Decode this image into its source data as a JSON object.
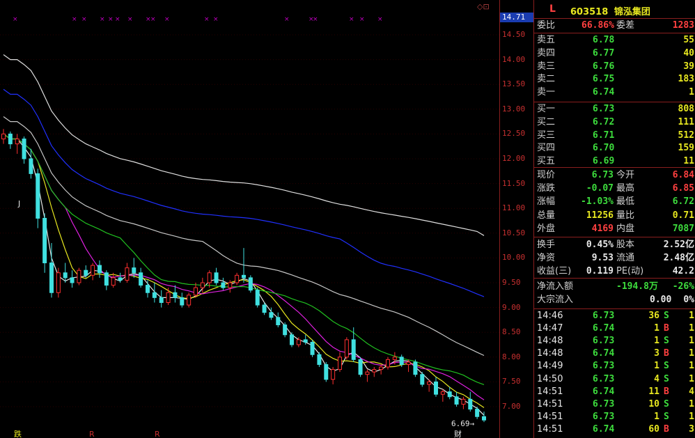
{
  "header": {
    "market_flag": "L",
    "stock_code": "603518",
    "stock_name": "锦泓集团"
  },
  "axis": {
    "current_price_tag": "14.71",
    "ticks": [
      "14.50",
      "14.00",
      "13.50",
      "13.00",
      "12.50",
      "12.00",
      "11.50",
      "11.00",
      "10.50",
      "10.00",
      "9.50",
      "9.00",
      "8.50",
      "8.00",
      "7.50",
      "7.00"
    ],
    "min_price_label": "6.69",
    "corner_icons": "◇⊡"
  },
  "chart_markers": {
    "top_marks": "×",
    "left_mark": "J",
    "bottom_tags": [
      "跌",
      "R",
      "R",
      "财"
    ]
  },
  "chart_data": {
    "type": "candlestick",
    "price_range": [
      6.6,
      14.8
    ],
    "candles": [
      [
        12.4,
        12.6,
        12.3,
        12.5
      ],
      [
        12.5,
        12.55,
        12.2,
        12.3
      ],
      [
        12.3,
        12.5,
        12.1,
        12.4
      ],
      [
        12.4,
        12.45,
        11.9,
        12.0
      ],
      [
        12.0,
        12.2,
        11.6,
        11.7
      ],
      [
        11.7,
        11.8,
        10.6,
        10.8
      ],
      [
        10.8,
        10.9,
        9.7,
        9.9
      ],
      [
        9.9,
        10.3,
        9.2,
        9.3
      ],
      [
        9.3,
        9.8,
        9.2,
        9.7
      ],
      [
        9.7,
        9.9,
        9.5,
        9.6
      ],
      [
        9.6,
        9.75,
        9.4,
        9.5
      ],
      [
        9.5,
        9.8,
        9.45,
        9.75
      ],
      [
        9.75,
        9.85,
        9.6,
        9.65
      ],
      [
        9.65,
        9.9,
        9.55,
        9.85
      ],
      [
        9.85,
        9.95,
        9.6,
        9.7
      ],
      [
        9.7,
        9.75,
        9.35,
        9.45
      ],
      [
        9.45,
        9.7,
        9.4,
        9.6
      ],
      [
        9.6,
        9.7,
        9.5,
        9.55
      ],
      [
        9.55,
        9.9,
        9.5,
        9.8
      ],
      [
        9.8,
        10.0,
        9.6,
        9.7
      ],
      [
        9.7,
        9.8,
        9.4,
        9.45
      ],
      [
        9.45,
        9.55,
        9.2,
        9.3
      ],
      [
        9.3,
        9.5,
        9.1,
        9.2
      ],
      [
        9.2,
        9.35,
        9.0,
        9.1
      ],
      [
        9.1,
        9.4,
        9.05,
        9.3
      ],
      [
        9.3,
        9.45,
        9.1,
        9.2
      ],
      [
        9.2,
        9.3,
        9.0,
        9.05
      ],
      [
        9.05,
        9.3,
        9.0,
        9.25
      ],
      [
        9.25,
        9.5,
        9.2,
        9.4
      ],
      [
        9.4,
        9.6,
        9.3,
        9.5
      ],
      [
        9.5,
        9.75,
        9.4,
        9.7
      ],
      [
        9.7,
        9.8,
        9.45,
        9.5
      ],
      [
        9.5,
        9.6,
        9.35,
        9.4
      ],
      [
        9.4,
        9.55,
        9.3,
        9.5
      ],
      [
        9.5,
        9.7,
        9.45,
        9.65
      ],
      [
        9.65,
        10.2,
        9.5,
        9.6
      ],
      [
        9.6,
        9.65,
        9.3,
        9.35
      ],
      [
        9.35,
        9.4,
        9.0,
        9.05
      ],
      [
        9.05,
        9.1,
        8.85,
        8.9
      ],
      [
        8.9,
        9.0,
        8.75,
        8.8
      ],
      [
        8.8,
        8.9,
        8.6,
        8.65
      ],
      [
        8.65,
        8.7,
        8.4,
        8.45
      ],
      [
        8.45,
        8.5,
        8.2,
        8.25
      ],
      [
        8.25,
        8.4,
        8.2,
        8.35
      ],
      [
        8.35,
        8.45,
        8.25,
        8.3
      ],
      [
        8.3,
        8.35,
        8.0,
        8.05
      ],
      [
        8.05,
        8.1,
        7.8,
        7.85
      ],
      [
        7.85,
        7.9,
        7.5,
        7.55
      ],
      [
        7.55,
        7.8,
        7.45,
        7.75
      ],
      [
        7.75,
        8.1,
        7.7,
        8.0
      ],
      [
        8.0,
        8.4,
        7.95,
        8.35
      ],
      [
        8.35,
        8.6,
        7.9,
        7.95
      ],
      [
        7.95,
        8.0,
        7.6,
        7.65
      ],
      [
        7.65,
        7.75,
        7.5,
        7.7
      ],
      [
        7.7,
        7.8,
        7.6,
        7.75
      ],
      [
        7.75,
        7.85,
        7.65,
        7.8
      ],
      [
        7.8,
        8.0,
        7.75,
        7.95
      ],
      [
        7.95,
        8.1,
        7.85,
        8.0
      ],
      [
        8.0,
        8.05,
        7.8,
        7.85
      ],
      [
        7.85,
        7.95,
        7.7,
        7.9
      ],
      [
        7.9,
        7.95,
        7.6,
        7.65
      ],
      [
        7.65,
        7.7,
        7.4,
        7.45
      ],
      [
        7.45,
        7.55,
        7.3,
        7.5
      ],
      [
        7.5,
        7.6,
        7.2,
        7.25
      ],
      [
        7.25,
        7.35,
        7.1,
        7.3
      ],
      [
        7.3,
        7.4,
        7.15,
        7.2
      ],
      [
        7.2,
        7.3,
        7.0,
        7.05
      ],
      [
        7.05,
        7.2,
        6.95,
        7.15
      ],
      [
        7.15,
        7.3,
        6.9,
        6.95
      ],
      [
        6.95,
        7.0,
        6.75,
        6.8
      ],
      [
        6.8,
        6.9,
        6.69,
        6.73
      ]
    ]
  },
  "panel": {
    "weibi": {
      "label": "委比",
      "value": "66.86%",
      "label2": "委差",
      "value2": "1283"
    },
    "asks": [
      {
        "label": "卖五",
        "price": "6.78",
        "vol": "55"
      },
      {
        "label": "卖四",
        "price": "6.77",
        "vol": "40"
      },
      {
        "label": "卖三",
        "price": "6.76",
        "vol": "39"
      },
      {
        "label": "卖二",
        "price": "6.75",
        "vol": "183"
      },
      {
        "label": "卖一",
        "price": "6.74",
        "vol": "1"
      }
    ],
    "bids": [
      {
        "label": "买一",
        "price": "6.73",
        "vol": "808"
      },
      {
        "label": "买二",
        "price": "6.72",
        "vol": "111"
      },
      {
        "label": "买三",
        "price": "6.71",
        "vol": "512"
      },
      {
        "label": "买四",
        "price": "6.70",
        "vol": "159"
      },
      {
        "label": "买五",
        "price": "6.69",
        "vol": "11"
      }
    ],
    "quote": [
      {
        "l1": "现价",
        "v1": "6.73",
        "l2": "今开",
        "v2": "6.84"
      },
      {
        "l1": "涨跌",
        "v1": "-0.07",
        "l2": "最高",
        "v2": "6.85"
      },
      {
        "l1": "涨幅",
        "v1": "-1.03%",
        "l2": "最低",
        "v2": "6.72"
      },
      {
        "l1": "总量",
        "v1": "11256",
        "l2": "量比",
        "v2": "0.71"
      },
      {
        "l1": "外盘",
        "v1": "4169",
        "l2": "内盘",
        "v2": "7087"
      }
    ],
    "finance": [
      {
        "l1": "换手",
        "v1": "0.45%",
        "l2": "股本",
        "v2": "2.52亿"
      },
      {
        "l1": "净资",
        "v1": "9.53",
        "l2": "流通",
        "v2": "2.48亿"
      },
      {
        "l1": "收益(三)",
        "v1": "0.119",
        "l2": "PE(动)",
        "v2": "42.2"
      }
    ],
    "flow": {
      "net_label": "净流入额",
      "net_value": "-194.8万",
      "net_pct": "-26%",
      "big_label": "大宗流入",
      "big_value": "0.00",
      "big_pct": "0%"
    },
    "ticks": [
      {
        "time": "14:46",
        "price": "6.73",
        "vol": "36",
        "side": "S",
        "n": "1"
      },
      {
        "time": "14:47",
        "price": "6.74",
        "vol": "1",
        "side": "B",
        "n": "1"
      },
      {
        "time": "14:48",
        "price": "6.73",
        "vol": "1",
        "side": "S",
        "n": "1"
      },
      {
        "time": "14:48",
        "price": "6.74",
        "vol": "3",
        "side": "B",
        "n": "1"
      },
      {
        "time": "14:49",
        "price": "6.73",
        "vol": "1",
        "side": "S",
        "n": "1"
      },
      {
        "time": "14:50",
        "price": "6.73",
        "vol": "4",
        "side": "S",
        "n": "1"
      },
      {
        "time": "14:51",
        "price": "6.74",
        "vol": "11",
        "side": "B",
        "n": "4"
      },
      {
        "time": "14:51",
        "price": "6.73",
        "vol": "10",
        "side": "S",
        "n": "1"
      },
      {
        "time": "14:51",
        "price": "6.73",
        "vol": "1",
        "side": "S",
        "n": "1"
      },
      {
        "time": "14:51",
        "price": "6.74",
        "vol": "60",
        "side": "B",
        "n": "3"
      }
    ]
  }
}
